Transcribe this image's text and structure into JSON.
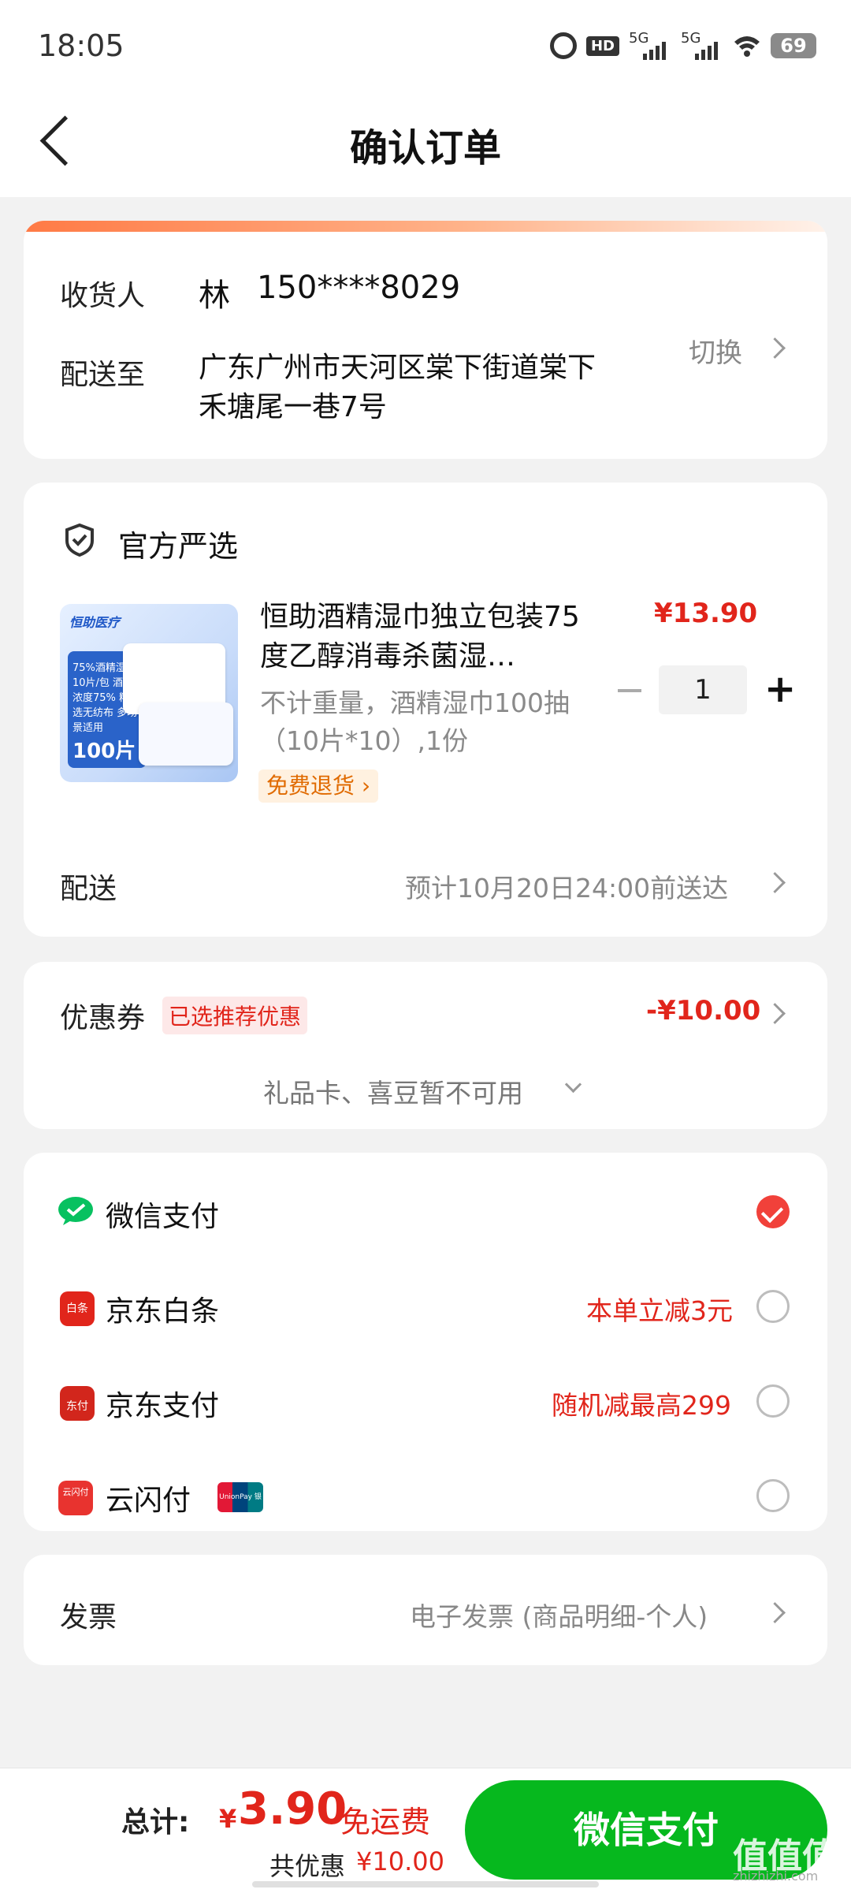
{
  "status_bar": {
    "time": "18:05",
    "hd": "HD",
    "sig1": "5G",
    "sig2": "5G",
    "battery": "69"
  },
  "header": {
    "title": "确认订单"
  },
  "address": {
    "recipient_label": "收货人",
    "recipient_name": "林",
    "recipient_phone": "150****8029",
    "ship_to_label": "配送至",
    "address_line1": "广东广州市天河区棠下街道棠下",
    "address_line2": "禾塘尾一巷7号",
    "switch_label": "切换"
  },
  "product": {
    "store_badge": "官方严选",
    "name": "恒助酒精湿巾独立包装75度乙醇消毒杀菌湿…",
    "price": "¥13.90",
    "spec": "不计重量，酒精湿巾100抽（10片*10）,1份",
    "free_return": "免费退货 ›",
    "quantity": "1",
    "image": {
      "brand": "恒助医疗",
      "text1": "75%酒精湿巾 10片/包 酒精浓度75% 精选无纺布 多场景适用",
      "text2": "100片"
    },
    "delivery_label": "配送",
    "delivery_value": "预计10月20日24:00前送达"
  },
  "coupon": {
    "label": "优惠券",
    "tag": "已选推荐优惠",
    "value": "-¥10.00",
    "unavailable": "礼品卡、喜豆暂不可用"
  },
  "payment": {
    "methods": [
      {
        "label": "微信支付",
        "promo": "",
        "checked": true
      },
      {
        "label": "京东白条",
        "promo": "本单立减3元",
        "checked": false
      },
      {
        "label": "京东支付",
        "promo": "随机减最高299",
        "checked": false
      },
      {
        "label": "云闪付",
        "promo": "",
        "checked": false
      }
    ],
    "unionpay_badge": "UnionPay 银联",
    "icon_text": {
      "baitiao": "白条",
      "jdpay": "东付",
      "yunshanfu": "云闪付"
    }
  },
  "invoice": {
    "label": "发票",
    "value": "电子发票 (商品明细-个人)"
  },
  "footer": {
    "total_label": "总计:",
    "currency": "¥",
    "total_value": "3.90",
    "shipping": "免运费",
    "saving_label": "共优惠",
    "saving_value": "¥10.00",
    "pay_button": "微信支付",
    "watermark": "值值值",
    "watermark_sub": "zhizhizhi.com"
  },
  "colors": {
    "accent_red": "#e1251b",
    "wechat_green": "#06b81e",
    "check_red": "#f1413a"
  }
}
